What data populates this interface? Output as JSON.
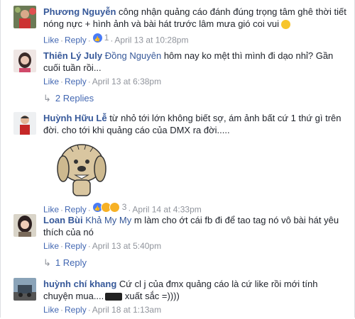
{
  "comments": [
    {
      "author": "Phương Nguyễn",
      "text": " công nhận quảng cáo đánh đúng trọng tâm ghê thời tiết nóng nực + hình ảnh và bài hát trước lâm mưa gió coi vui",
      "like": "Like",
      "reply": "Reply",
      "reaction_count": "1",
      "time": "April 13 at 10:28pm"
    },
    {
      "author": "Thiên Lý July",
      "tag": "Đồng Nguyên",
      "text": " hôm nay ko mệt thì mình đi dạo nhỉ? Gần cuối tuần rồi...",
      "like": "Like",
      "reply": "Reply",
      "time": "April 13 at 6:38pm",
      "replies": "2 Replies"
    },
    {
      "author": "Huỳnh Hữu Lễ",
      "text": " từ nhỏ tới lớn không biết sợ, ám ảnh bất cứ 1 thứ gì trên đời. cho tới khi quảng cáo của DMX ra đời.....",
      "like": "Like",
      "reply": "Reply",
      "reaction_count": "3",
      "time": "April 14 at 4:33pm"
    },
    {
      "author": "Loan Bùi",
      "tag": "Khả My My",
      "text": " m làm cho ớt cái fb đi để tao tag nó vô bài hát yêu thích của nó",
      "like": "Like",
      "reply": "Reply",
      "time": "April 13 at 5:40pm",
      "replies": "1 Reply"
    },
    {
      "author": "huỳnh chí khang",
      "text": " Cứ cl j của đmx quảng cáo là cứ like rồi mới tính chuyện mua....",
      "text_tail": " xuất sắc =))))",
      "like": "Like",
      "reply": "Reply",
      "time": "April 18 at 1:13am"
    }
  ],
  "colors": {
    "link": "#365899",
    "action": "#4267b2",
    "meta": "#90949c"
  }
}
